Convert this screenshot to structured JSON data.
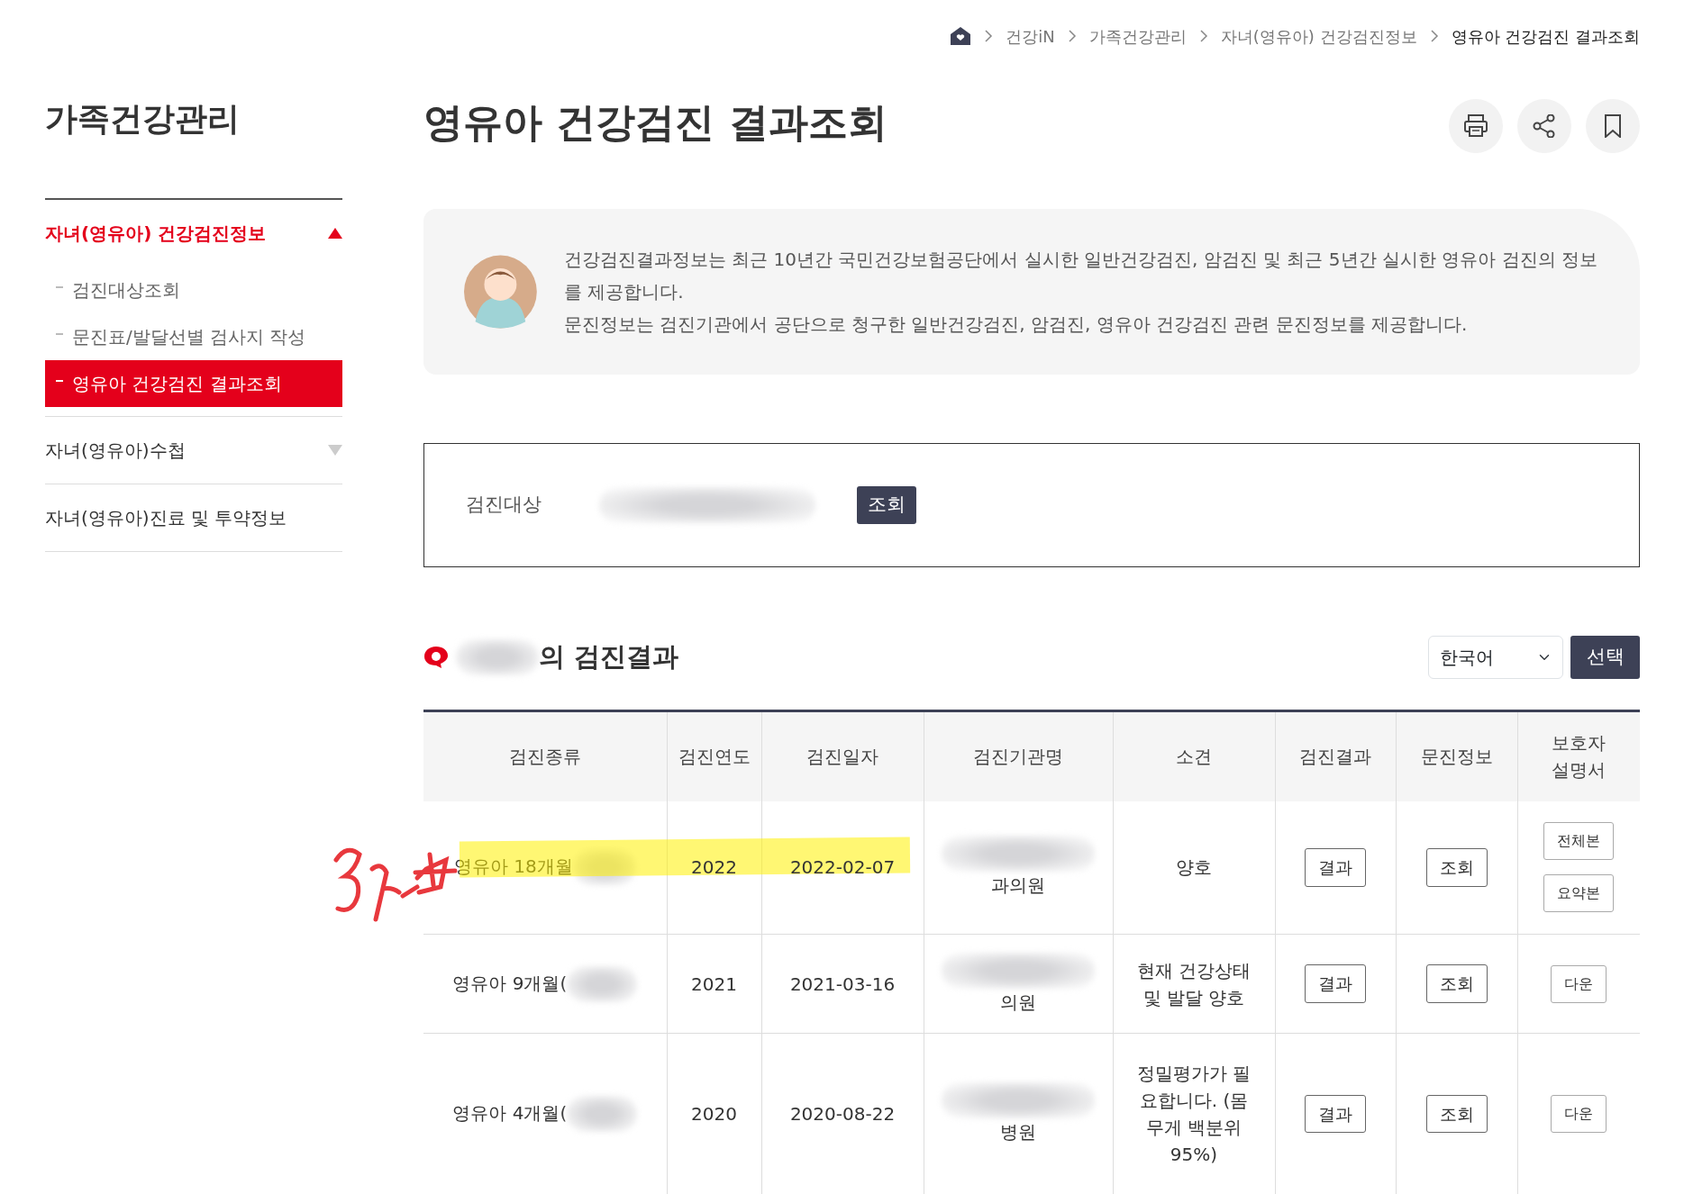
{
  "breadcrumb": [
    {
      "label": "건강iN"
    },
    {
      "label": "가족건강관리"
    },
    {
      "label": "자녀(영유아) 건강검진정보"
    },
    {
      "label": "영유아 건강검진 결과조회"
    }
  ],
  "sidebar": {
    "title": "가족건강관리",
    "items": [
      {
        "label": "자녀(영유아) 건강검진정보",
        "expanded": true,
        "children": [
          {
            "label": "검진대상조회",
            "selected": false
          },
          {
            "label": "문진표/발달선별 검사지 작성",
            "selected": false
          },
          {
            "label": "영유아 건강검진 결과조회",
            "selected": true
          }
        ]
      },
      {
        "label": "자녀(영유아)수첩",
        "expanded": false
      },
      {
        "label": "자녀(영유아)진료 및 투약정보"
      }
    ]
  },
  "page_title": "영유아 건강검진 결과조회",
  "info": [
    "건강검진결과정보는 최근 10년간 국민건강보험공단에서 실시한 일반건강검진, 암검진 및 최근 5년간 실시한 영유아 검진의 정보를 제공합니다.",
    "문진정보는 검진기관에서 공단으로 청구한 일반건강검진, 암검진, 영유아 건강검진 관련 문진정보를 제공합니다."
  ],
  "search": {
    "label": "검진대상",
    "button": "조회"
  },
  "results": {
    "title": "의 검진결과",
    "language": "한국어",
    "select_button": "선택",
    "columns": [
      "검진종류",
      "검진연도",
      "검진일자",
      "검진기관명",
      "소견",
      "검진결과",
      "문진정보",
      "보호자 설명서"
    ],
    "rows": [
      {
        "type": "영유아 18개월",
        "year": "2022",
        "date": "2022-02-07",
        "org": "과의원",
        "finding": "양호",
        "result": "결과",
        "question": "조회",
        "guide": [
          "전체본",
          "요약본"
        ],
        "highlighted": true
      },
      {
        "type": "영유아 9개월(",
        "year": "2021",
        "date": "2021-03-16",
        "org": "의원",
        "finding": "현재 건강상태 및 발달 양호",
        "result": "결과",
        "question": "조회",
        "guide": [
          "다운"
        ],
        "highlighted": false
      },
      {
        "type": "영유아 4개월(",
        "year": "2020",
        "date": "2020-08-22",
        "org": "병원",
        "finding": "정밀평가가 필요합니다. (몸무게 백분위 95%)",
        "result": "결과",
        "question": "조회",
        "guide": [
          "다운"
        ],
        "highlighted": false
      }
    ]
  }
}
